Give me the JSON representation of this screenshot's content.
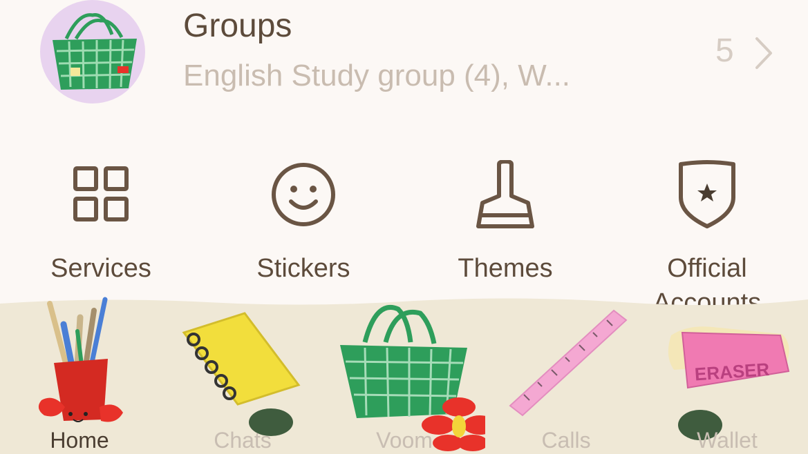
{
  "groups": {
    "title": "Groups",
    "subtitle": "English Study group (4), W...",
    "count": "5"
  },
  "shortcuts": [
    {
      "label": "Services",
      "icon": "grid-icon"
    },
    {
      "label": "Stickers",
      "icon": "smiley-icon"
    },
    {
      "label": "Themes",
      "icon": "brush-icon"
    },
    {
      "label": "Official Accounts",
      "icon": "shield-star-icon"
    }
  ],
  "tabs": [
    {
      "label": "Home",
      "icon": "pencil-cup-icon",
      "active": true
    },
    {
      "label": "Chats",
      "icon": "notebook-icon",
      "active": false
    },
    {
      "label": "Voom",
      "icon": "basket-icon",
      "active": false
    },
    {
      "label": "Calls",
      "icon": "ruler-icon",
      "active": false
    },
    {
      "label": "Wallet",
      "icon": "eraser-icon",
      "active": false
    }
  ],
  "eraser_text": "ERASER",
  "colors": {
    "background": "#fcf8f5",
    "tab_bar": "#efe8d6",
    "text_dark": "#5d4b3b",
    "text_muted": "#c9bcb0",
    "basket_green": "#2e9e5b",
    "flower_red": "#e8322a",
    "avatar_bg": "#e8d3ef"
  }
}
